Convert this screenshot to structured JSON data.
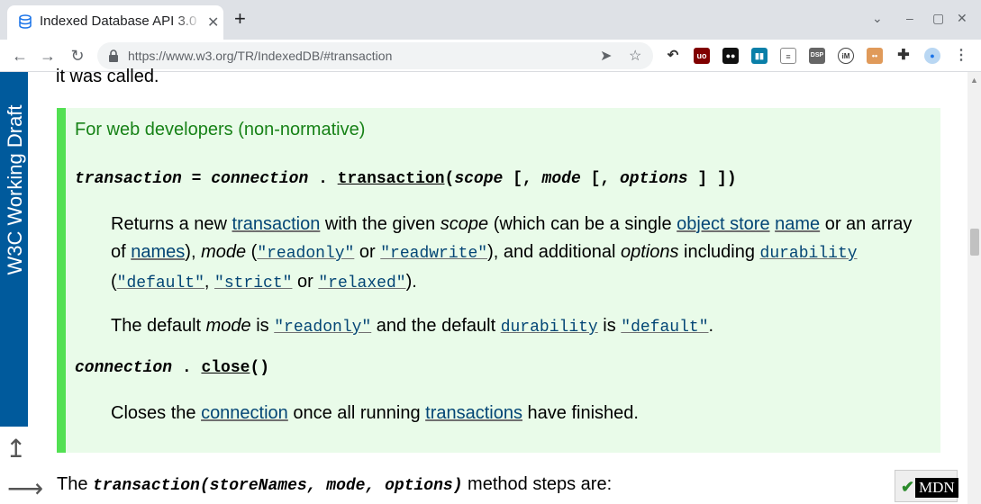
{
  "browser": {
    "tab_title": "Indexed Database API 3.0",
    "url_domain": "https://www.w3.org",
    "url_path": "/TR/IndexedDB/#transaction"
  },
  "sidebar": {
    "label": "W3C Working Draft"
  },
  "page": {
    "cut_line": "it was called.",
    "note_heading": "For web developers (non-normative)",
    "sig1": {
      "result": "transaction",
      "eq": " = ",
      "object": "connection",
      "dot": " . ",
      "method": "transaction",
      "open": "(",
      "arg1": "scope",
      "mid1": " [, ",
      "arg2": "mode",
      "mid2": " [, ",
      "arg3": "options",
      "close": " ] ])"
    },
    "para1": {
      "t1": "Returns a new ",
      "l_transaction": "transaction",
      "t2": " with the given ",
      "scope": "scope",
      "t3": " (which can be a single ",
      "l_object_store": "object store",
      "t4": " ",
      "l_name": "name",
      "t5": " or an array of ",
      "l_names": "names",
      "t6": "), ",
      "mode": "mode",
      "t7": " (",
      "l_readonly": "\"readonly\"",
      "t8": " or ",
      "l_readwrite": "\"readwrite\"",
      "t9": "), and additional ",
      "options": "options",
      "t10": " including ",
      "l_durability": "durability",
      "t11": " (",
      "l_default": "\"default\"",
      "t12": ", ",
      "l_strict": "\"strict\"",
      "t13": " or ",
      "l_relaxed": "\"relaxed\"",
      "t14": ")."
    },
    "para2": {
      "t1": "The default ",
      "mode": "mode",
      "t2": " is ",
      "l_readonly": "\"readonly\"",
      "t3": " and the default ",
      "l_durability": "durability",
      "t4": " is ",
      "l_default": "\"default\"",
      "t5": "."
    },
    "sig2": {
      "object": "connection",
      "dot": " . ",
      "method": "close",
      "parens": "()"
    },
    "para3": {
      "t1": "Closes the ",
      "l_connection": "connection",
      "t2": " once all running ",
      "l_transactions": "transactions",
      "t3": " have finished."
    },
    "steps": {
      "t1": "The ",
      "code": "transaction(storeNames, mode, options)",
      "t2": " method steps are:"
    }
  },
  "mdn_badge": {
    "label": "MDN",
    "check": "✔"
  }
}
